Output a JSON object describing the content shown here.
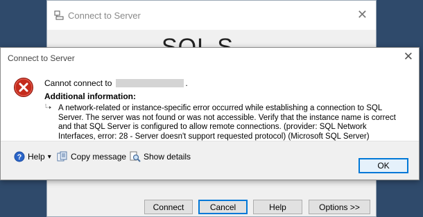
{
  "background_window": {
    "title": "Connect to Server",
    "logo_text": "SQL S",
    "buttons": {
      "connect": "Connect",
      "cancel": "Cancel",
      "help": "Help",
      "options": "Options >>"
    }
  },
  "error_dialog": {
    "title": "Connect to Server",
    "cannot_connect_prefix": "Cannot connect to",
    "cannot_connect_suffix": ".",
    "additional_info_heading": "Additional information:",
    "detail_message": "A network-related or instance-specific error occurred while establishing a connection to SQL Server. The server was not found or was not accessible. Verify that the instance name is correct and that SQL Server is configured to allow remote connections. (provider: SQL Network Interfaces, error: 28 - Server doesn't support requested protocol) (Microsoft SQL Server)",
    "footer": {
      "help_label": "Help",
      "help_dropdown": "▾",
      "copy_label": "Copy message",
      "show_details_label": "Show details",
      "ok_label": "OK"
    }
  },
  "colors": {
    "desktop": "#2f4a6b",
    "error_red": "#c42b1c",
    "focus_blue": "#0078d7"
  }
}
